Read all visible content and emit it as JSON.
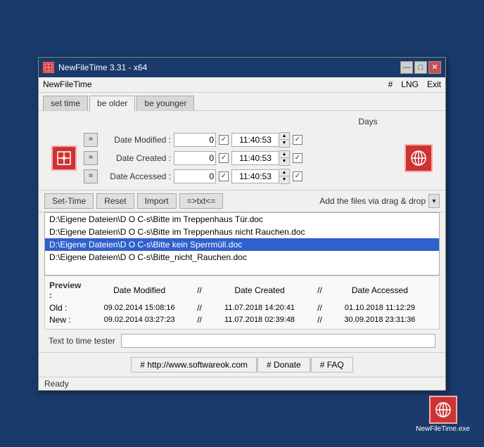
{
  "window": {
    "title": "NewFileTime 3.31 - x64",
    "icon": "⊞",
    "minimize": "—",
    "restore": "□",
    "close": "✕"
  },
  "menubar": {
    "app_name": "NewFileTime",
    "hash": "#",
    "lng": "LNG",
    "exit": "Exit"
  },
  "tabs": [
    {
      "label": "set time",
      "active": false
    },
    {
      "label": "be older",
      "active": true
    },
    {
      "label": "be younger",
      "active": false
    }
  ],
  "days_header": "Days",
  "rows": [
    {
      "eq_label": "=",
      "label": "Date Modified :",
      "days_value": "0",
      "time_value": "11:40:53",
      "checked": true,
      "end_checked": true
    },
    {
      "eq_label": "=",
      "label": "Date Created :",
      "days_value": "0",
      "time_value": "11:40:53",
      "checked": true,
      "end_checked": true
    },
    {
      "eq_label": "=",
      "label": "Date Accessed :",
      "days_value": "0",
      "time_value": "11:40:53",
      "checked": true,
      "end_checked": true
    }
  ],
  "toolbar": {
    "set_time": "Set-Time",
    "reset": "Reset",
    "import": "Import",
    "txt": "=>txt<=",
    "drag_drop": "Add the files via drag & drop"
  },
  "files": [
    {
      "path": "D:\\Eigene Dateien\\D O C-s\\Bitte im Treppenhaus Tür.doc",
      "selected": false
    },
    {
      "path": "D:\\Eigene Dateien\\D O C-s\\Bitte im Treppenhaus nicht Rauchen.doc",
      "selected": false
    },
    {
      "path": "D:\\Eigene Dateien\\D O C-s\\Bitte kein Sperrmüll.doc",
      "selected": true
    },
    {
      "path": "D:\\Eigene Dateien\\D O C-s\\Bitte_nicht_Rauchen.doc",
      "selected": false
    }
  ],
  "preview": {
    "title": "Preview :",
    "headers": {
      "date_modified": "Date Modified",
      "sep1": "//",
      "date_created": "Date Created",
      "sep2": "//",
      "date_accessed": "Date Accessed"
    },
    "old_label": "Old :",
    "new_label": "New :",
    "old_values": {
      "date_modified": "09.02.2014 15:08:16",
      "date_created": "11.07.2018 14:20:41",
      "date_accessed": "01.10.2018 11:12:29"
    },
    "new_values": {
      "date_modified": "09.02.2014 03:27:23",
      "date_created": "11.07.2018 02:39:48",
      "date_accessed": "30.09.2018 23:31:36"
    }
  },
  "text_tester": {
    "label": "Text to time tester",
    "value": "",
    "placeholder": ""
  },
  "footer": {
    "link1": "# http://www.softwareok.com",
    "link2": "# Donate",
    "link3": "# FAQ"
  },
  "status": "Ready",
  "taskbar_exe": "NewFileTime.exe"
}
